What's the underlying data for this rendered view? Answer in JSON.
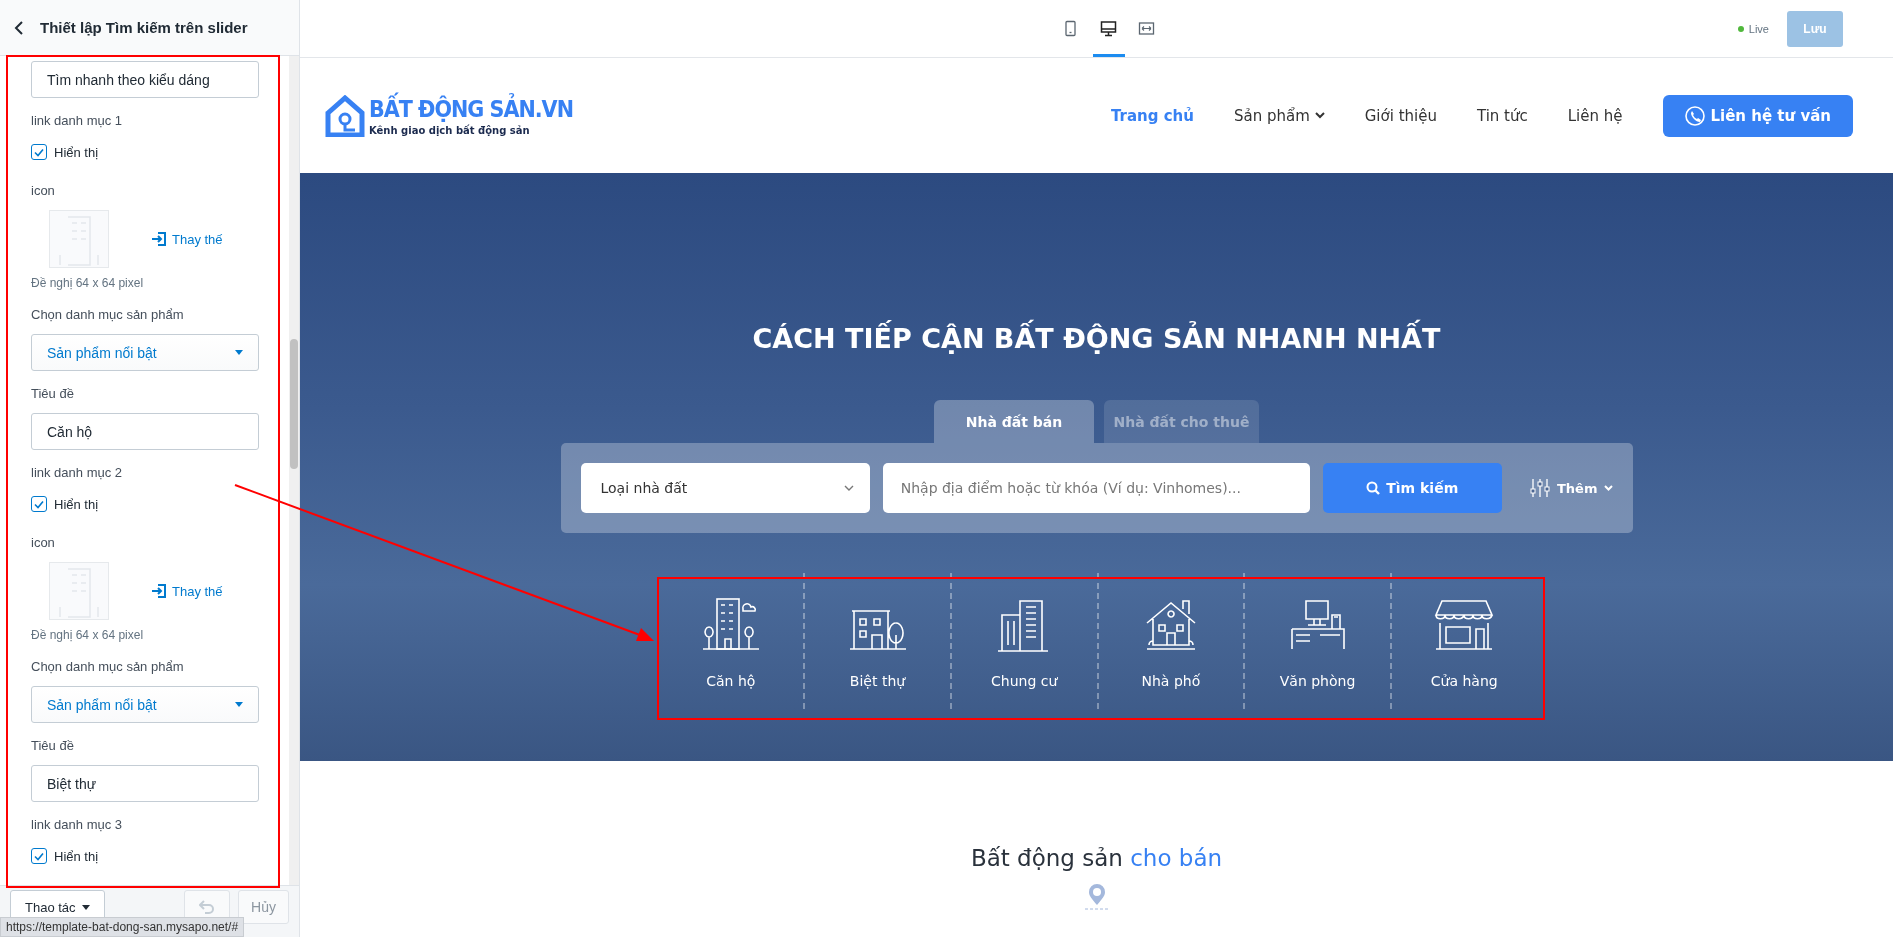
{
  "panel": {
    "title": "Thiết lập Tìm kiếm trên slider",
    "items": [
      {
        "kind": "input",
        "value": "Tìm nhanh theo kiểu dáng"
      },
      {
        "kind": "label",
        "text": "link danh mục 1"
      },
      {
        "kind": "checkbox",
        "label": "Hiển thị",
        "checked": true
      },
      {
        "kind": "label",
        "text": "icon"
      },
      {
        "kind": "image",
        "action": "Thay thế",
        "hint": "Đề nghị 64 x 64 pixel"
      },
      {
        "kind": "label",
        "text": "Chọn danh mục sản phẩm"
      },
      {
        "kind": "select",
        "value": "Sản phẩm nổi bật"
      },
      {
        "kind": "label",
        "text": "Tiêu đề"
      },
      {
        "kind": "input",
        "value": "Căn hộ"
      },
      {
        "kind": "label",
        "text": "link danh mục 2"
      },
      {
        "kind": "checkbox",
        "label": "Hiển thị",
        "checked": true
      },
      {
        "kind": "label",
        "text": "icon"
      },
      {
        "kind": "image",
        "action": "Thay thế",
        "hint": "Đề nghị 64 x 64 pixel"
      },
      {
        "kind": "label",
        "text": "Chọn danh mục sản phẩm"
      },
      {
        "kind": "select",
        "value": "Sản phẩm nổi bật"
      },
      {
        "kind": "label",
        "text": "Tiêu đề"
      },
      {
        "kind": "input",
        "value": "Biệt thự"
      },
      {
        "kind": "label",
        "text": "link danh mục 3"
      },
      {
        "kind": "checkbox",
        "label": "Hiển thị",
        "checked": true
      }
    ],
    "footer": {
      "actions": "Thao tác",
      "cancel": "Hủy",
      "cancel_disabled": true
    }
  },
  "status_bar": "https://template-bat-dong-san.mysapo.net/#",
  "toolbar": {
    "view_modes": [
      {
        "kind": "mobile",
        "selected": false
      },
      {
        "kind": "desktop",
        "selected": true
      },
      {
        "kind": "fullwidth",
        "selected": false
      }
    ],
    "live": "Live",
    "save": "Lưu",
    "save_disabled": true
  },
  "site": {
    "logo": {
      "title": "BẤT ĐỘNG SẢN.VN",
      "tagline": "Kênh giao dịch bất động sản"
    },
    "nav": [
      {
        "label": "Trang chủ",
        "selected": true,
        "dropdown": false
      },
      {
        "label": "Sản phẩm",
        "selected": false,
        "dropdown": true
      },
      {
        "label": "Giới thiệu",
        "selected": false,
        "dropdown": false
      },
      {
        "label": "Tin tức",
        "selected": false,
        "dropdown": false
      },
      {
        "label": "Liên hệ",
        "selected": false,
        "dropdown": false
      }
    ],
    "cta": "Liên hệ tư vấn",
    "hero": {
      "title": "CÁCH TIẾP CẬN BẤT ĐỘNG SẢN NHANH NHẤT",
      "tabs": [
        {
          "label": "Nhà đất bán",
          "selected": true
        },
        {
          "label": "Nhà đất cho thuê",
          "selected": false
        }
      ],
      "type_select": "Loại nhà đất",
      "keyword_placeholder": "Nhập địa điểm hoặc từ khóa (Ví dụ: Vinhomes)...",
      "search_button": "Tìm kiếm",
      "more": "Thêm",
      "categories": [
        {
          "kind": "apartment",
          "label": "Căn hộ"
        },
        {
          "kind": "villa",
          "label": "Biệt thự"
        },
        {
          "kind": "tower",
          "label": "Chung cư"
        },
        {
          "kind": "house",
          "label": "Nhà phố"
        },
        {
          "kind": "office",
          "label": "Văn phòng"
        },
        {
          "kind": "shop",
          "label": "Cửa hàng"
        }
      ]
    },
    "section": {
      "text": "Bất động sản",
      "highlight": "cho bán"
    }
  }
}
